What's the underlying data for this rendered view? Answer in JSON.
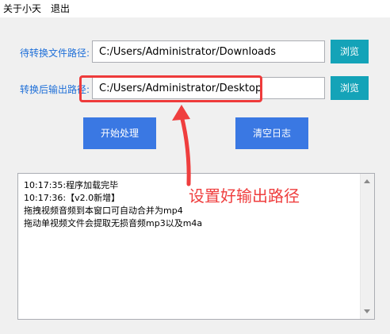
{
  "menu": {
    "items": [
      "关于小天",
      "退出"
    ]
  },
  "source_row": {
    "label": "待转换文件路径:",
    "value": "C:/Users/Administrator/Downloads",
    "browse_label": "浏览"
  },
  "output_row": {
    "label": "转换后输出路径:",
    "value": "C:/Users/Administrator/Desktop",
    "browse_label": "浏览"
  },
  "actions": {
    "start_label": "开始处理",
    "clear_log_label": "清空日志"
  },
  "log": {
    "lines": [
      "10:17:35:程序加载完毕",
      "10:17:36:【v2.0新增】",
      "拖拽视频音频到本窗口可自动合并为mp4",
      "拖动单视频文件会提取无损音频mp3以及m4a"
    ]
  },
  "annotation": {
    "text": "设置好输出路径",
    "color": "#ef3e3e"
  },
  "colors": {
    "label_blue": "#1e6fd8",
    "browse_teal": "#14a3b8",
    "action_blue": "#3a78e3",
    "highlight_red": "#ee3b3b"
  }
}
